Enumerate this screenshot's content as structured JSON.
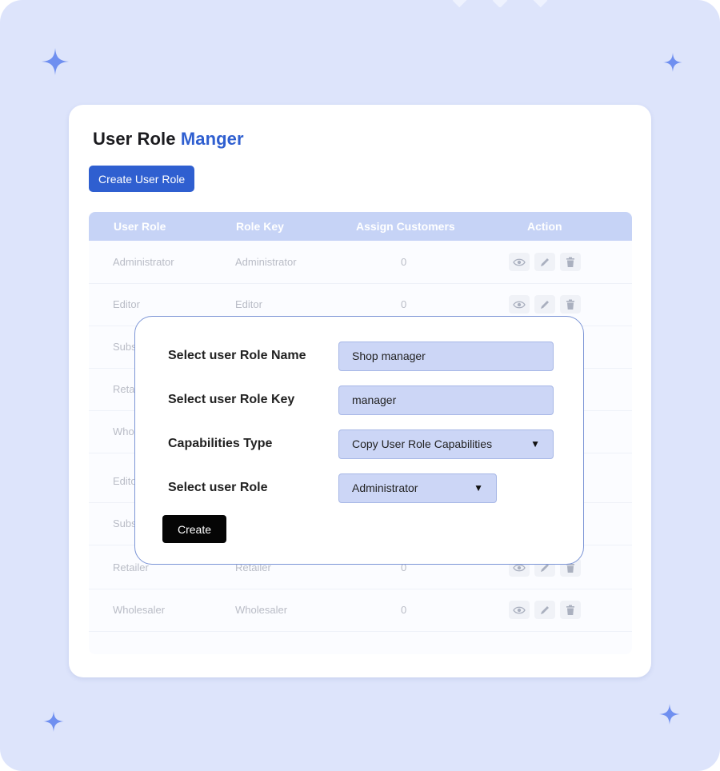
{
  "header": {
    "title_main": "User Role",
    "title_accent": "Manger",
    "create_button": "Create User Role"
  },
  "table": {
    "columns": [
      "User Role",
      "Role Key",
      "Assign Customers",
      "Action"
    ],
    "rows": [
      {
        "role": "Administrator",
        "key": "Administrator",
        "customers": "0"
      },
      {
        "role": "Editor",
        "key": "Editor",
        "customers": "0"
      },
      {
        "role": "Subs",
        "key": "",
        "customers": ""
      },
      {
        "role": "Retai",
        "key": "",
        "customers": ""
      },
      {
        "role": "Whol",
        "key": "",
        "customers": ""
      },
      {
        "role": "Edito",
        "key": "",
        "customers": ""
      },
      {
        "role": "Subs",
        "key": "",
        "customers": ""
      },
      {
        "role": "Retailer",
        "key": "Retailer",
        "customers": "0"
      },
      {
        "role": "Wholesaler",
        "key": "Wholesaler",
        "customers": "0"
      }
    ],
    "action_icons": [
      "eye-icon",
      "pencil-icon",
      "trash-icon"
    ]
  },
  "modal": {
    "fields": [
      {
        "label": "Select user Role Name",
        "value": "Shop manager"
      },
      {
        "label": "Select user Role Key",
        "value": "manager"
      },
      {
        "label": "Capabilities Type",
        "value": "Copy User Role Capabilities"
      },
      {
        "label": "Select user Role",
        "value": "Administrator"
      }
    ],
    "create_button": "Create"
  },
  "colors": {
    "background": "#dde4fb",
    "accent": "#2f5fd0",
    "table_header": "#c6d3f6",
    "field": "#ccd6f6"
  }
}
